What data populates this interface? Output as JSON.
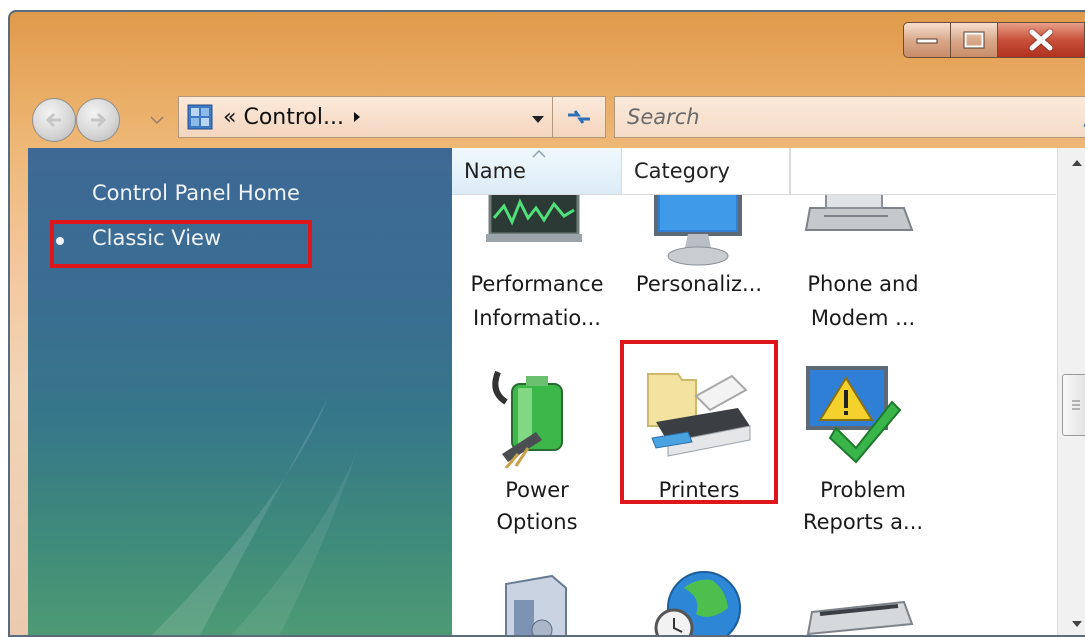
{
  "window": {
    "controls": [
      "minimize",
      "maximize",
      "close"
    ]
  },
  "navbar": {
    "address_text": "« Control...",
    "search_placeholder": "Search"
  },
  "left_pane": {
    "links": [
      {
        "label": "Control Panel Home"
      },
      {
        "label": "Classic View",
        "bulleted": true,
        "highlighted": true
      }
    ]
  },
  "list": {
    "columns": [
      "Name",
      "Category"
    ],
    "items": [
      {
        "label_1": "Performance",
        "label_2": "Informatio...",
        "icon": "performance-monitor-icon"
      },
      {
        "label_1": "Personaliz...",
        "label_2": "",
        "icon": "monitor-icon"
      },
      {
        "label_1": "Phone and",
        "label_2": "Modem ...",
        "icon": "phone-modem-icon"
      },
      {
        "label_1": "Power",
        "label_2": "Options",
        "icon": "battery-plug-icon"
      },
      {
        "label_1": "Printers",
        "label_2": "",
        "icon": "printer-icon",
        "highlighted": true
      },
      {
        "label_1": "Problem",
        "label_2": "Reports a...",
        "icon": "warning-check-icon"
      }
    ],
    "partial_row_icons": [
      "program-box-icon",
      "globe-clock-icon",
      "scanner-icon"
    ]
  },
  "colors": {
    "highlight": "#e0161d",
    "pane_top": "#3e6995",
    "pane_bottom": "#4e9b74"
  }
}
